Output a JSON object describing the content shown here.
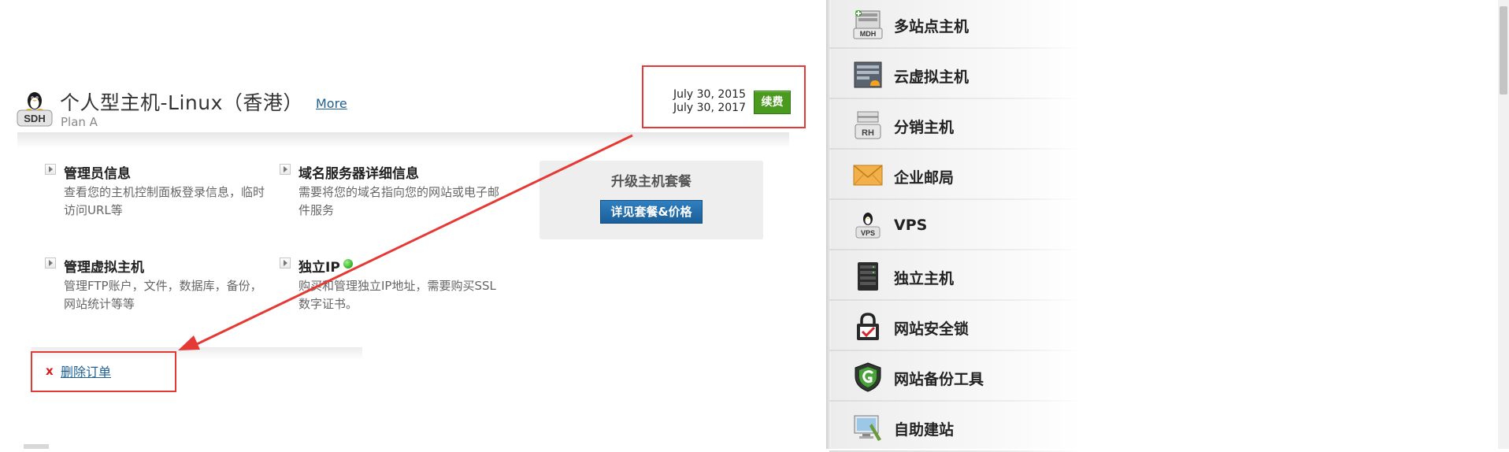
{
  "product": {
    "icon": "linux-sdh-icon",
    "icon_text": "SDH",
    "title": "个人型主机-Linux（香港）",
    "more_label": "More",
    "plan": "Plan A",
    "start_date": "July 30, 2015",
    "end_date": "July 30, 2017",
    "renew_label": "续费"
  },
  "features": [
    {
      "title": "管理员信息",
      "desc": "查看您的主机控制面板登录信息，临时访问URL等"
    },
    {
      "title": "域名服务器详细信息",
      "desc": "需要将您的域名指向您的网站或电子邮件服务"
    },
    {
      "title": "管理虚拟主机",
      "desc": "管理FTP账户，文件，数据库，备份，网站统计等等"
    },
    {
      "title": "独立IP",
      "desc": "购买和管理独立IP地址，需要购买SSL数字证书。"
    }
  ],
  "upgrade": {
    "title": "升级主机套餐",
    "button_label": "详见套餐&价格"
  },
  "delete": {
    "x_label": "x",
    "link_label": "删除订单"
  },
  "sidebar": {
    "items": [
      {
        "label": "多站点主机",
        "icon": "mdh-server-icon",
        "icon_text": "MDH"
      },
      {
        "label": "云虚拟主机",
        "icon": "cloud-hosting-icon"
      },
      {
        "label": "分销主机",
        "icon": "reseller-rh-icon",
        "icon_text": "RH"
      },
      {
        "label": "企业邮局",
        "icon": "envelope-icon"
      },
      {
        "label": "VPS",
        "icon": "linux-vps-icon",
        "icon_text": "VPS"
      },
      {
        "label": "独立主机",
        "icon": "dedicated-server-icon"
      },
      {
        "label": "网站安全锁",
        "icon": "security-lock-icon"
      },
      {
        "label": "网站备份工具",
        "icon": "backup-shield-icon"
      },
      {
        "label": "自助建站",
        "icon": "site-builder-icon"
      }
    ]
  },
  "colors": {
    "renew_green": "#4a9a1f",
    "upgrade_blue": "#1b5f99",
    "annotation_red": "#e53935",
    "link_blue": "#1f5f8f",
    "status_dot_green": "#3dbb2f"
  }
}
